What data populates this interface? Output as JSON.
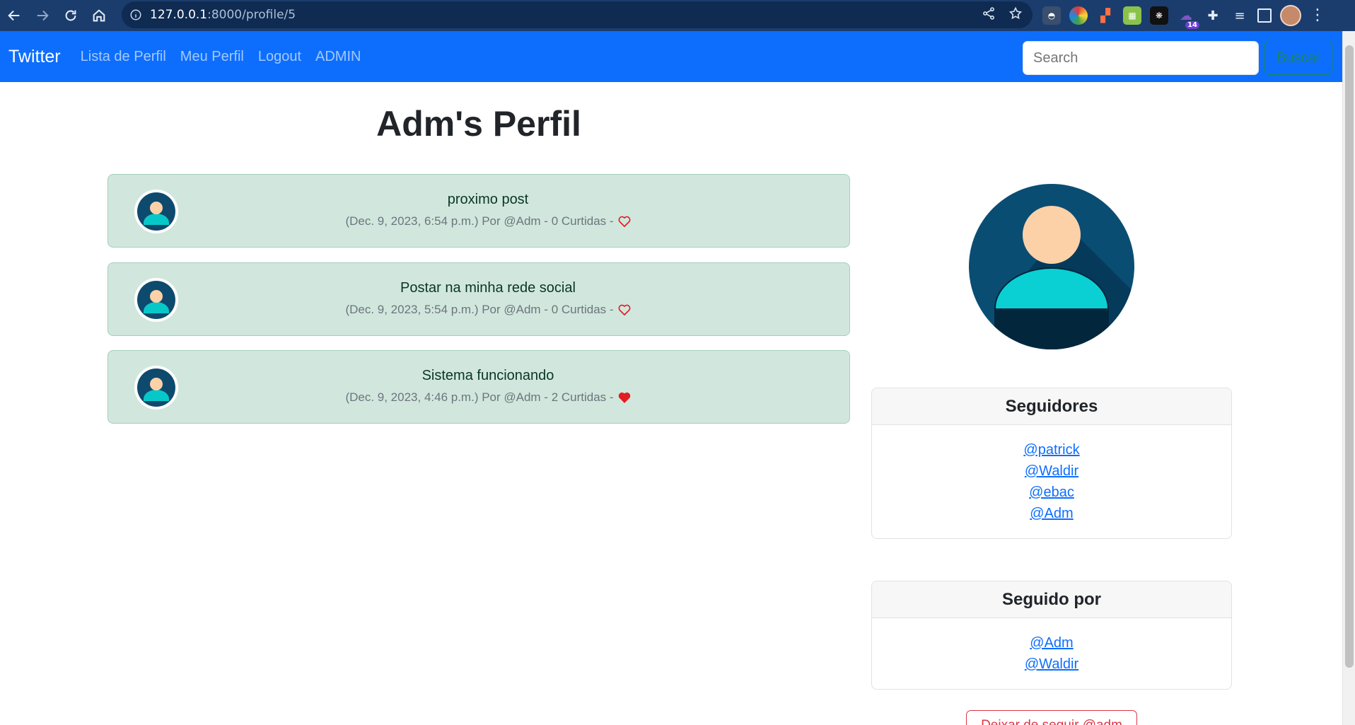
{
  "browser": {
    "url_host": "127.0.0.1",
    "url_path": ":8000/profile/5",
    "extension_badge": "14"
  },
  "navbar": {
    "brand": "Twitter",
    "links": [
      "Lista de Perfil",
      "Meu Perfil",
      "Logout",
      "ADMIN"
    ],
    "search_placeholder": "Search",
    "search_button": "Buscar"
  },
  "page": {
    "title": "Adm's Perfil"
  },
  "posts": [
    {
      "text": "proximo post",
      "meta": "(Dec. 9, 2023, 6:54 p.m.) Por @Adm - 0 Curtidas -",
      "liked": false
    },
    {
      "text": "Postar na minha rede social",
      "meta": "(Dec. 9, 2023, 5:54 p.m.) Por @Adm - 0 Curtidas -",
      "liked": false
    },
    {
      "text": "Sistema funcionando",
      "meta": "(Dec. 9, 2023, 4:46 p.m.) Por @Adm - 2 Curtidas -",
      "liked": true
    }
  ],
  "followers_card": {
    "title": "Seguidores",
    "users": [
      "@patrick",
      "@Waldir",
      "@ebac",
      "@Adm"
    ]
  },
  "following_card": {
    "title": "Seguido por",
    "users": [
      "@Adm",
      "@Waldir"
    ]
  },
  "unfollow_button": "Deixar de seguir @adm",
  "colors": {
    "navbar": "#0d6efd",
    "post_bg": "#d1e7dd",
    "heart": "#e31b23",
    "link": "#0d6efd",
    "danger": "#dc3545",
    "success": "#198754"
  }
}
